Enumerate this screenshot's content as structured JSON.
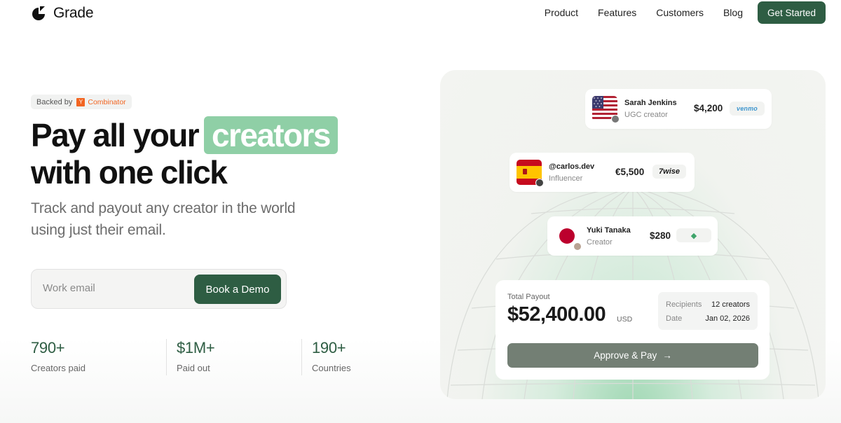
{
  "brand": {
    "name": "Grade"
  },
  "nav": {
    "links": [
      "Product",
      "Features",
      "Customers",
      "Blog"
    ],
    "cta": "Get Started"
  },
  "hero": {
    "badge_prefix": "Backed by",
    "badge_logo_letter": "Y",
    "badge_logo_text": "Combinator",
    "headline_line1": "Pay all your",
    "headline_highlight": "creators",
    "headline_line2": "with one click",
    "subheadline": "Track and payout any creator in the world using just their email.",
    "email_placeholder": "Work email",
    "demo_button": "Book a Demo"
  },
  "stats": [
    {
      "value": "790+",
      "label": "Creators paid"
    },
    {
      "value": "$1M+",
      "label": "Paid out"
    },
    {
      "value": "190+",
      "label": "Countries"
    }
  ],
  "payouts": [
    {
      "name": "Sarah Jenkins",
      "role": "UGC creator",
      "amount": "$4,200",
      "method": "venmo",
      "flag": "us-flag"
    },
    {
      "name": "@carlos.dev",
      "role": "Influencer",
      "amount": "€5,500",
      "method": "7wise",
      "flag": "spain-flag"
    },
    {
      "name": "Yuki Tanaka",
      "role": "Creator",
      "amount": "$280",
      "method": "gem-icon",
      "flag": "japan-flag"
    }
  ],
  "summary": {
    "label": "Total Payout",
    "amount": "$52,400.00",
    "currency": "USD",
    "recipients_label": "Recipients",
    "recipients_value": "12 creators",
    "date_label": "Date",
    "date_value": "Jan 02, 2026",
    "approve_button": "Approve & Pay",
    "approve_icon": "→"
  },
  "colors": {
    "brand_green": "#2e5d43",
    "highlight_green": "#8fcfa6",
    "approve_gray_green": "#737f74"
  }
}
